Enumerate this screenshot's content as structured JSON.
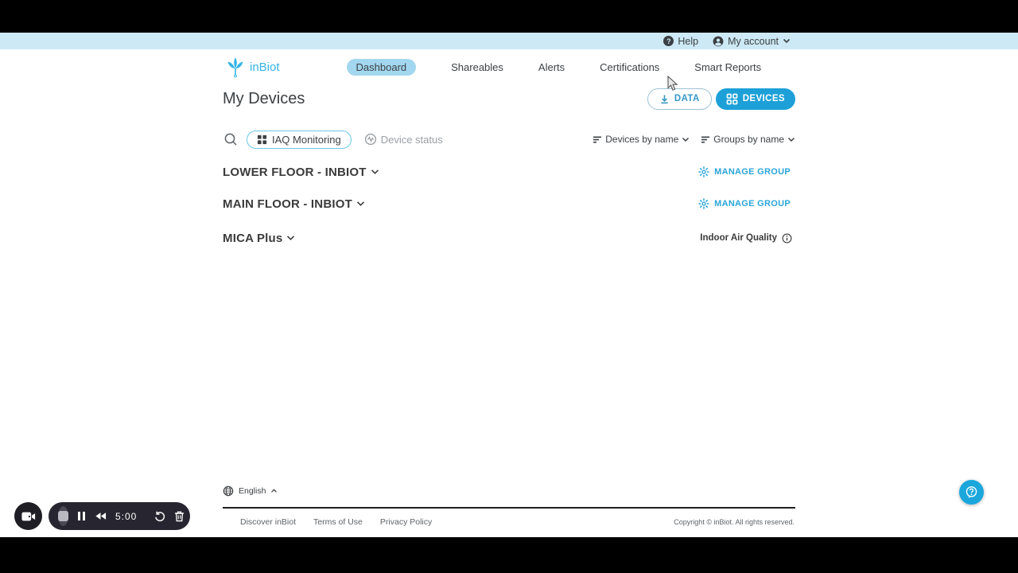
{
  "topbar": {
    "help_label": "Help",
    "account_label": "My account"
  },
  "nav": {
    "brand": "inBiot",
    "items": [
      {
        "label": "Dashboard",
        "active": true
      },
      {
        "label": "Shareables",
        "active": false
      },
      {
        "label": "Alerts",
        "active": false
      },
      {
        "label": "Certifications",
        "active": false
      },
      {
        "label": "Smart Reports",
        "active": false
      }
    ]
  },
  "page": {
    "title": "My Devices",
    "data_button": "DATA",
    "devices_button": "DEVICES"
  },
  "filters": {
    "iaq_toggle": "IAQ Monitoring",
    "device_status": "Device status",
    "sort_devices": "Devices by name",
    "sort_groups": "Groups by name"
  },
  "groups": [
    {
      "name": "LOWER FLOOR - INBIOT",
      "action": "MANAGE GROUP"
    },
    {
      "name": "MAIN FLOOR - INBIOT",
      "action": "MANAGE GROUP"
    },
    {
      "name": "MICA Plus",
      "action": "Indoor Air Quality"
    }
  ],
  "footer": {
    "language": "English",
    "links": [
      {
        "label": "Discover inBiot"
      },
      {
        "label": "Terms of Use"
      },
      {
        "label": "Privacy Policy"
      }
    ],
    "copyright": "Copyright © inBiot. All rights reserved."
  },
  "recorder": {
    "time": "5:00"
  },
  "colors": {
    "accent_cyan": "#1da0d8",
    "brand_cyan": "#35b4e5",
    "topbar_blue": "#cde9f5",
    "active_pill_blue": "#a2d7ef",
    "text_dark": "#3c4043"
  }
}
